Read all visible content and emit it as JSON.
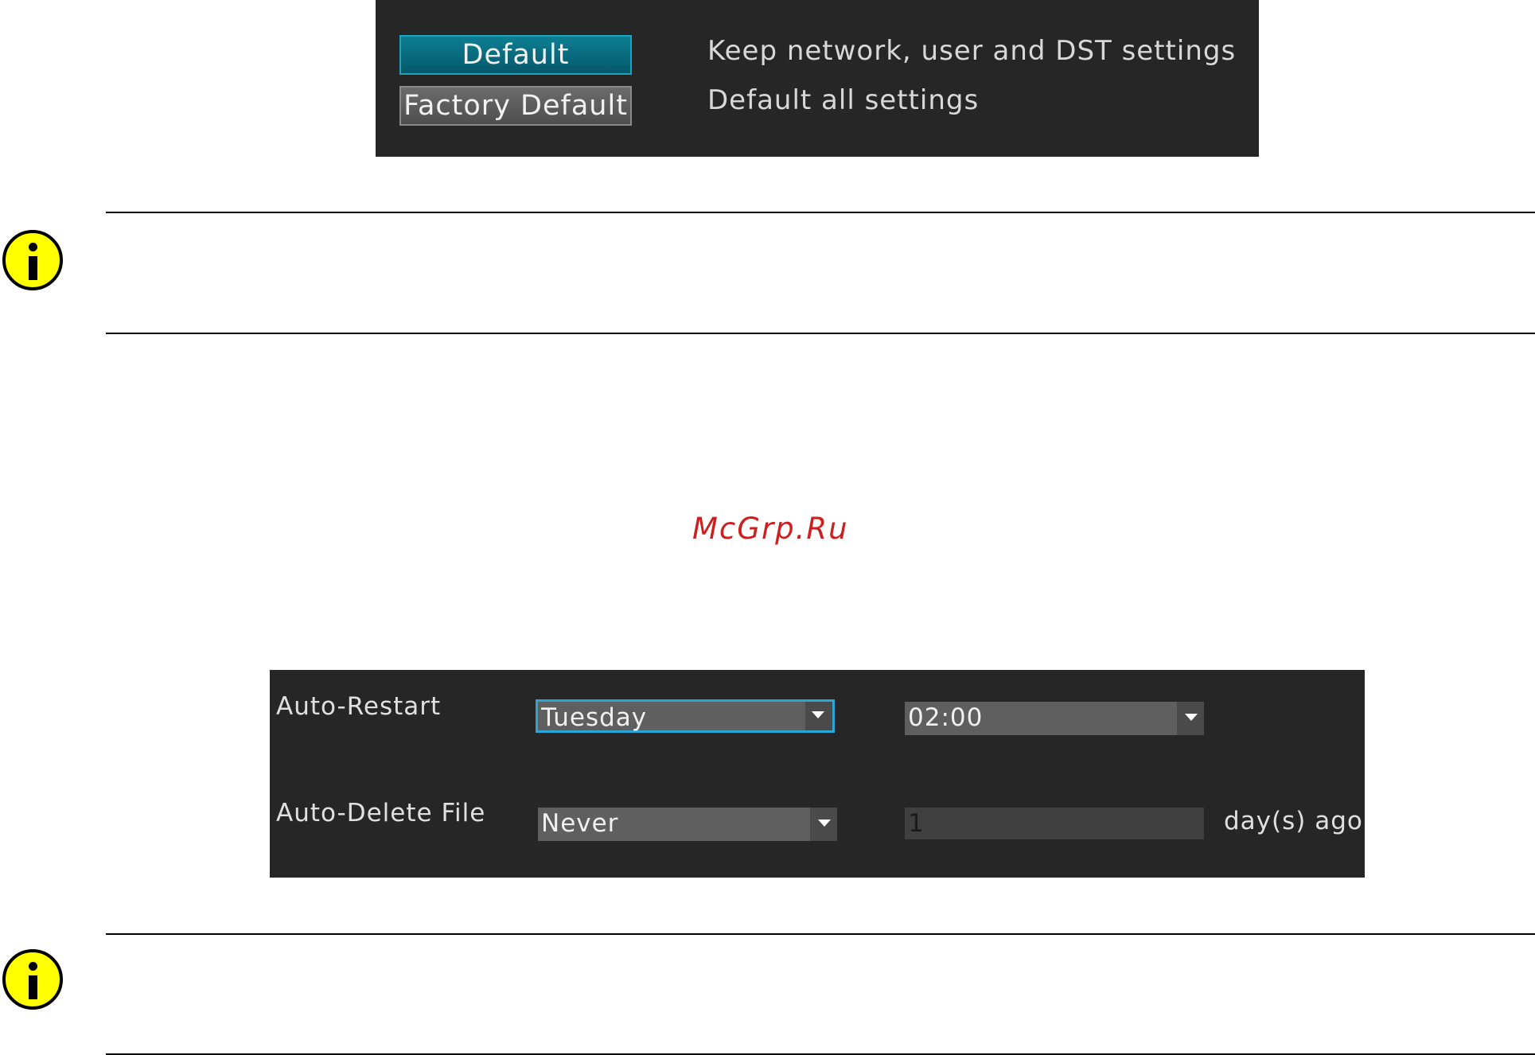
{
  "reset_panel": {
    "default_button": "Default",
    "default_desc": "Keep network, user and DST settings",
    "factory_button": "Factory Default",
    "factory_desc": "Default all settings"
  },
  "watermark": "McGrp.Ru",
  "maintenance_panel": {
    "auto_restart_label": "Auto-Restart",
    "auto_restart_day": "Tuesday",
    "auto_restart_time": "02:00",
    "auto_delete_label": "Auto-Delete File",
    "auto_delete_mode": "Never",
    "auto_delete_days": "1",
    "auto_delete_suffix": "day(s) ago"
  },
  "colors": {
    "panel_bg": "#262626",
    "accent": "#0d7f93",
    "focus_border": "#2aa6d6",
    "note_icon": "#ffff00",
    "watermark": "#cc1f1f"
  },
  "icons": {
    "note": "info-icon",
    "dropdown": "chevron-down-icon"
  }
}
